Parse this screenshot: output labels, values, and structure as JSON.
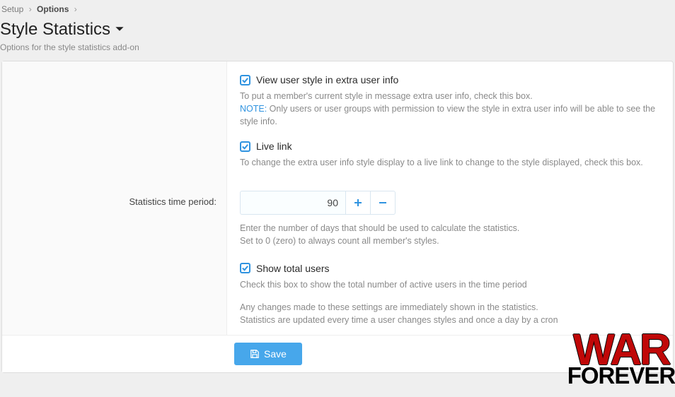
{
  "breadcrumb": {
    "setup": "Setup",
    "options": "Options"
  },
  "page_title": "Style Statistics",
  "subtitle": "Options for the style statistics add-on",
  "opt1": {
    "label": "View user style in extra user info",
    "desc": "To put a member's current style in message extra user info, check this box.",
    "note_prefix": "NOTE:",
    "note_text": " Only users or user groups with permission to view the style in extra user info will be able to see the style info."
  },
  "opt2": {
    "label": "Live link",
    "desc": "To change the extra user info style display to a live link to change to the style displayed, check this box."
  },
  "stats_period": {
    "label": "Statistics time period:",
    "value": "90",
    "desc1": "Enter the number of days that should be used to calculate the statistics.",
    "desc2": "Set to 0 (zero) to always count all member's styles."
  },
  "opt3": {
    "label": "Show total users",
    "desc": "Check this box to show the total number of active users in the time period"
  },
  "footer": {
    "l1": "Any changes made to these settings are immediately shown in the statistics.",
    "l2": "Statistics are updated every time a user changes styles and once a day by a cron"
  },
  "save_label": "Save",
  "logo": {
    "l1": "WAR",
    "l2": "FOREVER"
  }
}
